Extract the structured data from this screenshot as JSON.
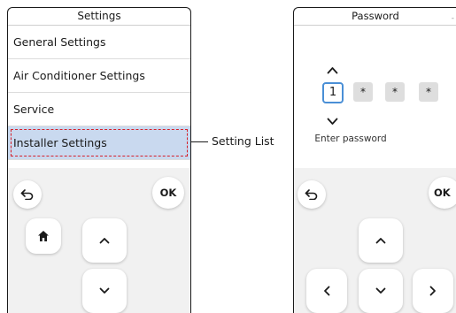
{
  "settings_screen": {
    "title": "Settings",
    "menu_items": [
      {
        "label": "General Settings"
      },
      {
        "label": "Air Conditioner Settings"
      },
      {
        "label": "Service"
      },
      {
        "label": "Installer Settings",
        "selected": true
      }
    ],
    "ok_label": "OK",
    "icons": [
      "back-icon",
      "home-icon",
      "chevron-up-icon",
      "chevron-down-icon"
    ]
  },
  "callout": {
    "label": "Setting List"
  },
  "password_screen": {
    "title": "Password",
    "title_marker": "-",
    "digits": [
      "1",
      "*",
      "*",
      "*"
    ],
    "active_digit_index": 0,
    "prompt": "Enter password",
    "ok_label": "OK",
    "icons": [
      "back-icon",
      "chevron-up-icon",
      "chevron-left-icon",
      "chevron-down-icon",
      "chevron-right-icon"
    ]
  },
  "colors": {
    "selected_row": "#c9d9ef",
    "highlight_dashed": "#d5202a",
    "active_digit_border": "#4a8fd6",
    "panel_background": "#f1f1f1"
  }
}
